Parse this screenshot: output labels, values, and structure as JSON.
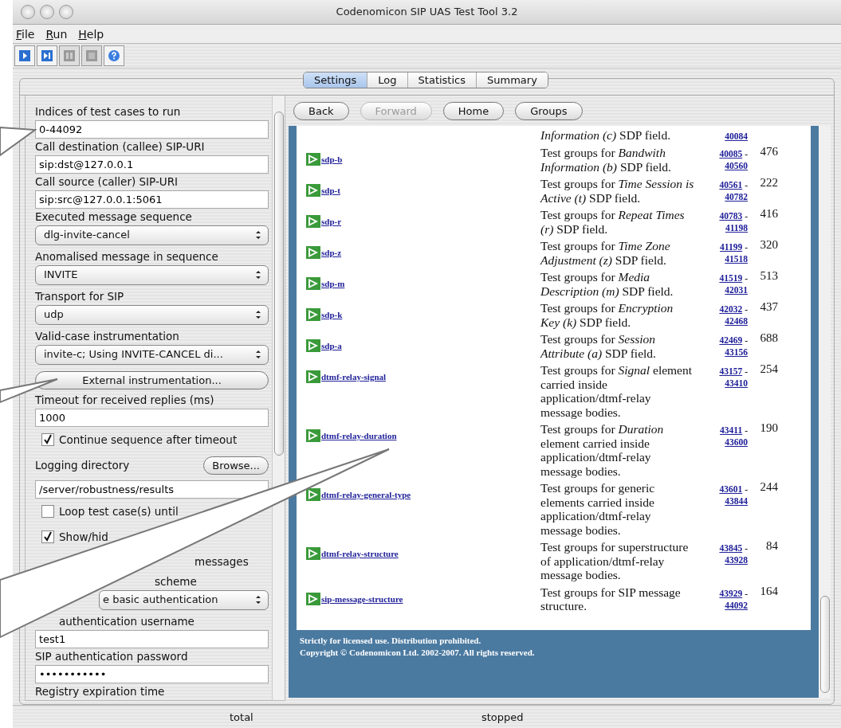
{
  "window": {
    "title": "Codenomicon SIP UAS Test Tool 3.2"
  },
  "menu": [
    {
      "label": "File"
    },
    {
      "label": "Run"
    },
    {
      "label": "Help"
    }
  ],
  "toolbar": [
    {
      "kind": "run",
      "disabled": false
    },
    {
      "kind": "step",
      "disabled": false
    },
    {
      "kind": "pause",
      "disabled": true
    },
    {
      "kind": "stop",
      "disabled": true
    },
    {
      "kind": "help",
      "disabled": false
    }
  ],
  "tabs": [
    {
      "label": "Settings",
      "selected": true
    },
    {
      "label": "Log",
      "selected": false
    },
    {
      "label": "Statistics",
      "selected": false
    },
    {
      "label": "Summary",
      "selected": false
    }
  ],
  "settings": [
    {
      "kind": "label",
      "text": "Indices of test cases to run"
    },
    {
      "kind": "text",
      "text": "0-44092"
    },
    {
      "kind": "label",
      "text": "Call destination (callee) SIP-URI"
    },
    {
      "kind": "text",
      "text": "sip:dst@127.0.0.1"
    },
    {
      "kind": "label",
      "text": "Call source (caller) SIP-URI"
    },
    {
      "kind": "text",
      "text": "sip:src@127.0.0.1:5061"
    },
    {
      "kind": "label",
      "text": "Executed message sequence"
    },
    {
      "kind": "select",
      "text": "dlg-invite-cancel"
    },
    {
      "kind": "label",
      "text": "Anomalised message in sequence"
    },
    {
      "kind": "select",
      "text": "INVITE"
    },
    {
      "kind": "label",
      "text": "Transport for SIP"
    },
    {
      "kind": "select",
      "text": "udp"
    },
    {
      "kind": "label",
      "text": "Valid-case instrumentation"
    },
    {
      "kind": "select",
      "text": "invite-c; Using INVITE-CANCEL di..."
    },
    {
      "kind": "button",
      "text": "External instrumentation..."
    },
    {
      "kind": "label",
      "text": "Timeout for received replies (ms)"
    },
    {
      "kind": "text",
      "text": "1000"
    },
    {
      "kind": "check",
      "text": "Continue sequence after timeout",
      "checked": true
    },
    {
      "kind": "browse",
      "text": "Logging directory",
      "button": "Browse..."
    },
    {
      "kind": "text",
      "text": "/server/robustness/results"
    },
    {
      "kind": "check",
      "text": "Loop test case(s) until",
      "checked": false
    },
    {
      "kind": "check",
      "text": "Show/hid",
      "checked": true
    },
    {
      "kind": "fragment",
      "text": "messages"
    },
    {
      "kind": "fragment",
      "text": "scheme"
    },
    {
      "kind": "select-fragment",
      "text": "e basic authentication"
    },
    {
      "kind": "label",
      "text": "authentication username"
    },
    {
      "kind": "text",
      "text": "test1"
    },
    {
      "kind": "label",
      "text": "SIP authentication password"
    },
    {
      "kind": "text",
      "text": "•••••••••••"
    },
    {
      "kind": "label",
      "text": "Registry expiration time"
    }
  ],
  "nav_buttons": [
    {
      "label": "Back",
      "disabled": false
    },
    {
      "label": "Forward",
      "disabled": true
    },
    {
      "label": "Home",
      "disabled": false
    },
    {
      "label": "Groups",
      "disabled": false
    }
  ],
  "groups": [
    {
      "description": "*Information (c)* SDP field.",
      "range_end": "40084"
    },
    {
      "link": "sdp-b",
      "description": "Test groups for *Bandwith Information (b)* SDP field.",
      "range_start": "40085",
      "range_separator": "-",
      "range_end": "40560",
      "count": "476"
    },
    {
      "link": "sdp-t",
      "description": "Test groups for *Time Session is Active (t)* SDP field.",
      "range_start": "40561",
      "range_separator": "-",
      "range_end": "40782",
      "count": "222"
    },
    {
      "link": "sdp-r",
      "description": "Test groups for *Repeat Times (r)* SDP field.",
      "range_start": "40783",
      "range_separator": "-",
      "range_end": "41198",
      "count": "416"
    },
    {
      "link": "sdp-z",
      "description": "Test groups for *Time Zone Adjustment (z)* SDP field.",
      "range_start": "41199",
      "range_separator": "-",
      "range_end": "41518",
      "count": "320"
    },
    {
      "link": "sdp-m",
      "description": "Test groups for *Media Description (m)* SDP field.",
      "range_start": "41519",
      "range_separator": "-",
      "range_end": "42031",
      "count": "513"
    },
    {
      "link": "sdp-k",
      "description": "Test groups for *Encryption Key (k)* SDP field.",
      "range_start": "42032",
      "range_separator": "-",
      "range_end": "42468",
      "count": "437"
    },
    {
      "link": "sdp-a",
      "description": "Test groups for *Session Attribute (a)* SDP field.",
      "range_start": "42469",
      "range_separator": "-",
      "range_end": "43156",
      "count": "688"
    },
    {
      "link": "dtmf-relay-signal",
      "description": "Test groups for *Signal* element carried inside application/dtmf-relay message bodies.",
      "range_start": "43157",
      "range_separator": "-",
      "range_end": "43410",
      "count": "254"
    },
    {
      "link": "dtmf-relay-duration",
      "description": "Test groups for *Duration* element carried inside application/dtmf-relay message bodies.",
      "range_start": "43411",
      "range_separator": "-",
      "range_end": "43600",
      "count": "190"
    },
    {
      "link": "dtmf-relay-general-type",
      "description": "Test groups for generic elements carried inside application/dtmf-relay message bodies.",
      "range_start": "43601",
      "range_separator": "-",
      "range_end": "43844",
      "count": "244"
    },
    {
      "link": "dtmf-relay-structure",
      "description": "Test groups for superstructure of application/dtmf-relay message bodies.",
      "range_start": "43845",
      "range_separator": "-",
      "range_end": "43928",
      "count": "84"
    },
    {
      "link": "sip-message-structure",
      "description": "Test groups for SIP message structure.",
      "range_start": "43929",
      "range_separator": "-",
      "range_end": "44092",
      "count": "164"
    }
  ],
  "footer": [
    "Strictly for licensed use. Distribution prohibited.",
    "Copyright © Codenomicon Ltd. 2002-2007. All rights reserved."
  ],
  "status_bar": [
    "total",
    "stopped"
  ]
}
